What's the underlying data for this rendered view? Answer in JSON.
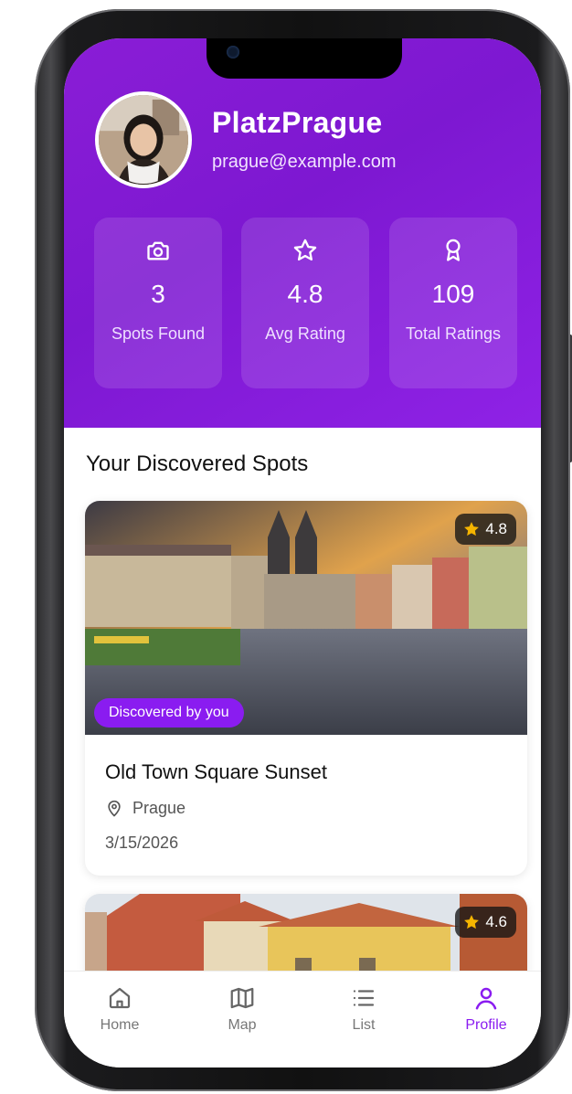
{
  "profile": {
    "username": "PlatzPrague",
    "email": "prague@example.com"
  },
  "stats": [
    {
      "icon": "camera-icon",
      "value": "3",
      "label": "Spots Found"
    },
    {
      "icon": "star-icon",
      "value": "4.8",
      "label": "Avg Rating"
    },
    {
      "icon": "award-icon",
      "value": "109",
      "label": "Total Ratings"
    }
  ],
  "section_title": "Your Discovered Spots",
  "spots": [
    {
      "title": "Old Town Square Sunset",
      "location": "Prague",
      "date": "3/15/2026",
      "rating": "4.8",
      "badge": "Discovered by you"
    },
    {
      "rating": "4.6"
    }
  ],
  "nav": [
    {
      "label": "Home",
      "icon": "home-icon",
      "active": false
    },
    {
      "label": "Map",
      "icon": "map-icon",
      "active": false
    },
    {
      "label": "List",
      "icon": "list-icon",
      "active": false
    },
    {
      "label": "Profile",
      "icon": "user-icon",
      "active": true
    }
  ],
  "colors": {
    "primary": "#8a1cf0",
    "header_gradient_start": "#8a1dd6",
    "header_gradient_end": "#8f22e6",
    "star": "#f5b400"
  }
}
